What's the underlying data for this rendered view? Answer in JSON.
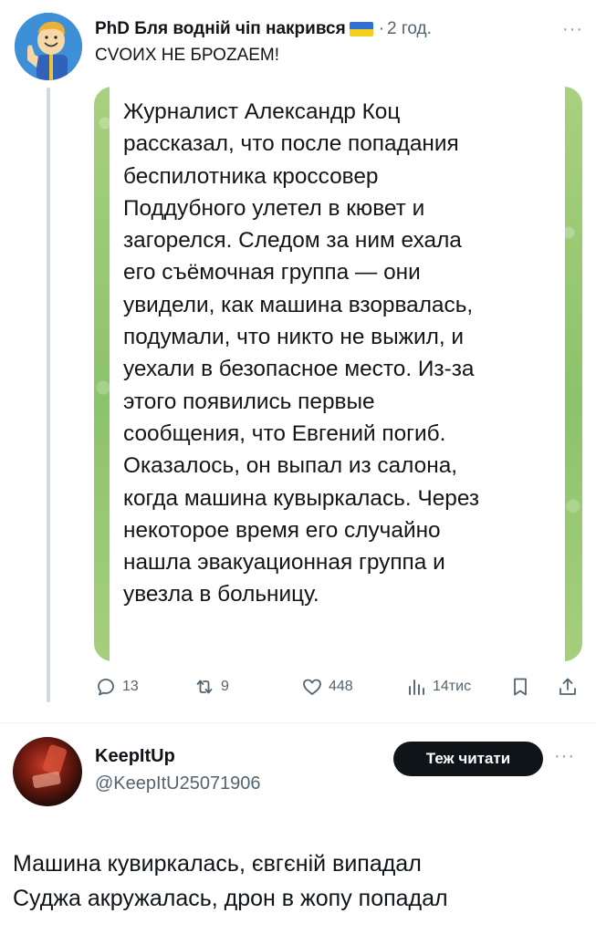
{
  "tweet1": {
    "display_name": "PhD Бля водній чіп накрився",
    "flag": "ukraine-flag-icon",
    "separator": "·",
    "time": "2 год.",
    "more": "···",
    "text": "CVOИХ НЕ БРОZАЕМ!",
    "image_text": "Журналист Александр Коц\nрассказал, что после попадания\nбеспилотника кроссовер\nПоддубного улетел в кювет и\nзагорелся. Следом за ним ехала\nего съёмочная группа — они\nувидели, как машина взорвалась,\nподумали, что никто не выжил, и\nуехали в безопасное место. Из-за\nэтого появились первые\nсообщения, что Евгений погиб.\nОказалось, он выпал из салона,\nкогда машина кувыркалась. Через\nнекоторое время его случайно\nнашла эвакуационная группа и\nувезла в больницу.",
    "actions": {
      "replies": "13",
      "retweets": "9",
      "likes": "448",
      "views": "14тис"
    }
  },
  "tweet2": {
    "display_name": "KeepItUp",
    "handle": "@KeepItU25071906",
    "follow_label": "Теж читати",
    "more": "···",
    "text": "Машина кувиркалась, євгєній випадал\nСуджа акружалась, дрон в жопу попадал"
  },
  "colors": {
    "text_primary": "#0f1419",
    "text_secondary": "#536471",
    "image_background_green": "#8cc36a",
    "follow_button_bg": "#0f1419"
  }
}
